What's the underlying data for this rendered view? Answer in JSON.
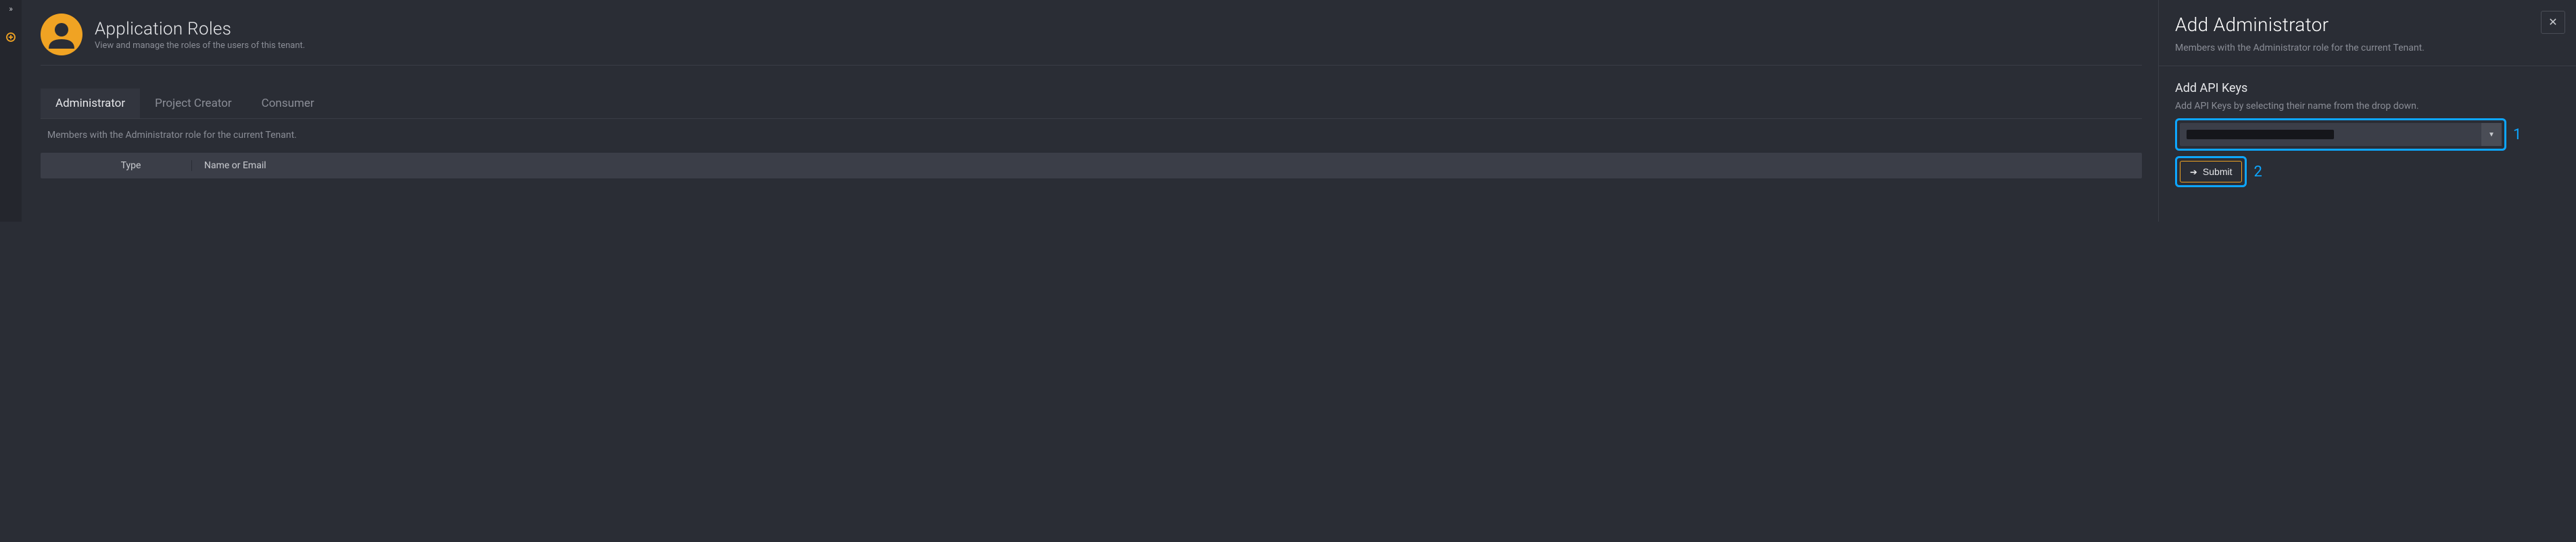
{
  "page": {
    "title": "Application Roles",
    "subtitle": "View and manage the roles of the users of this tenant."
  },
  "tabs": [
    {
      "label": "Administrator",
      "active": true
    },
    {
      "label": "Project Creator",
      "active": false
    },
    {
      "label": "Consumer",
      "active": false
    }
  ],
  "tab_description": "Members with the Administrator role for the current Tenant.",
  "table": {
    "columns": {
      "type": "Type",
      "name": "Name or Email"
    }
  },
  "panel": {
    "title": "Add Administrator",
    "subtitle": "Members with the Administrator role for the current Tenant.",
    "section_title": "Add API Keys",
    "section_desc": "Add API Keys by selecting their name from the drop down.",
    "submit_label": "Submit"
  },
  "callouts": {
    "dropdown": "1",
    "submit": "2"
  }
}
